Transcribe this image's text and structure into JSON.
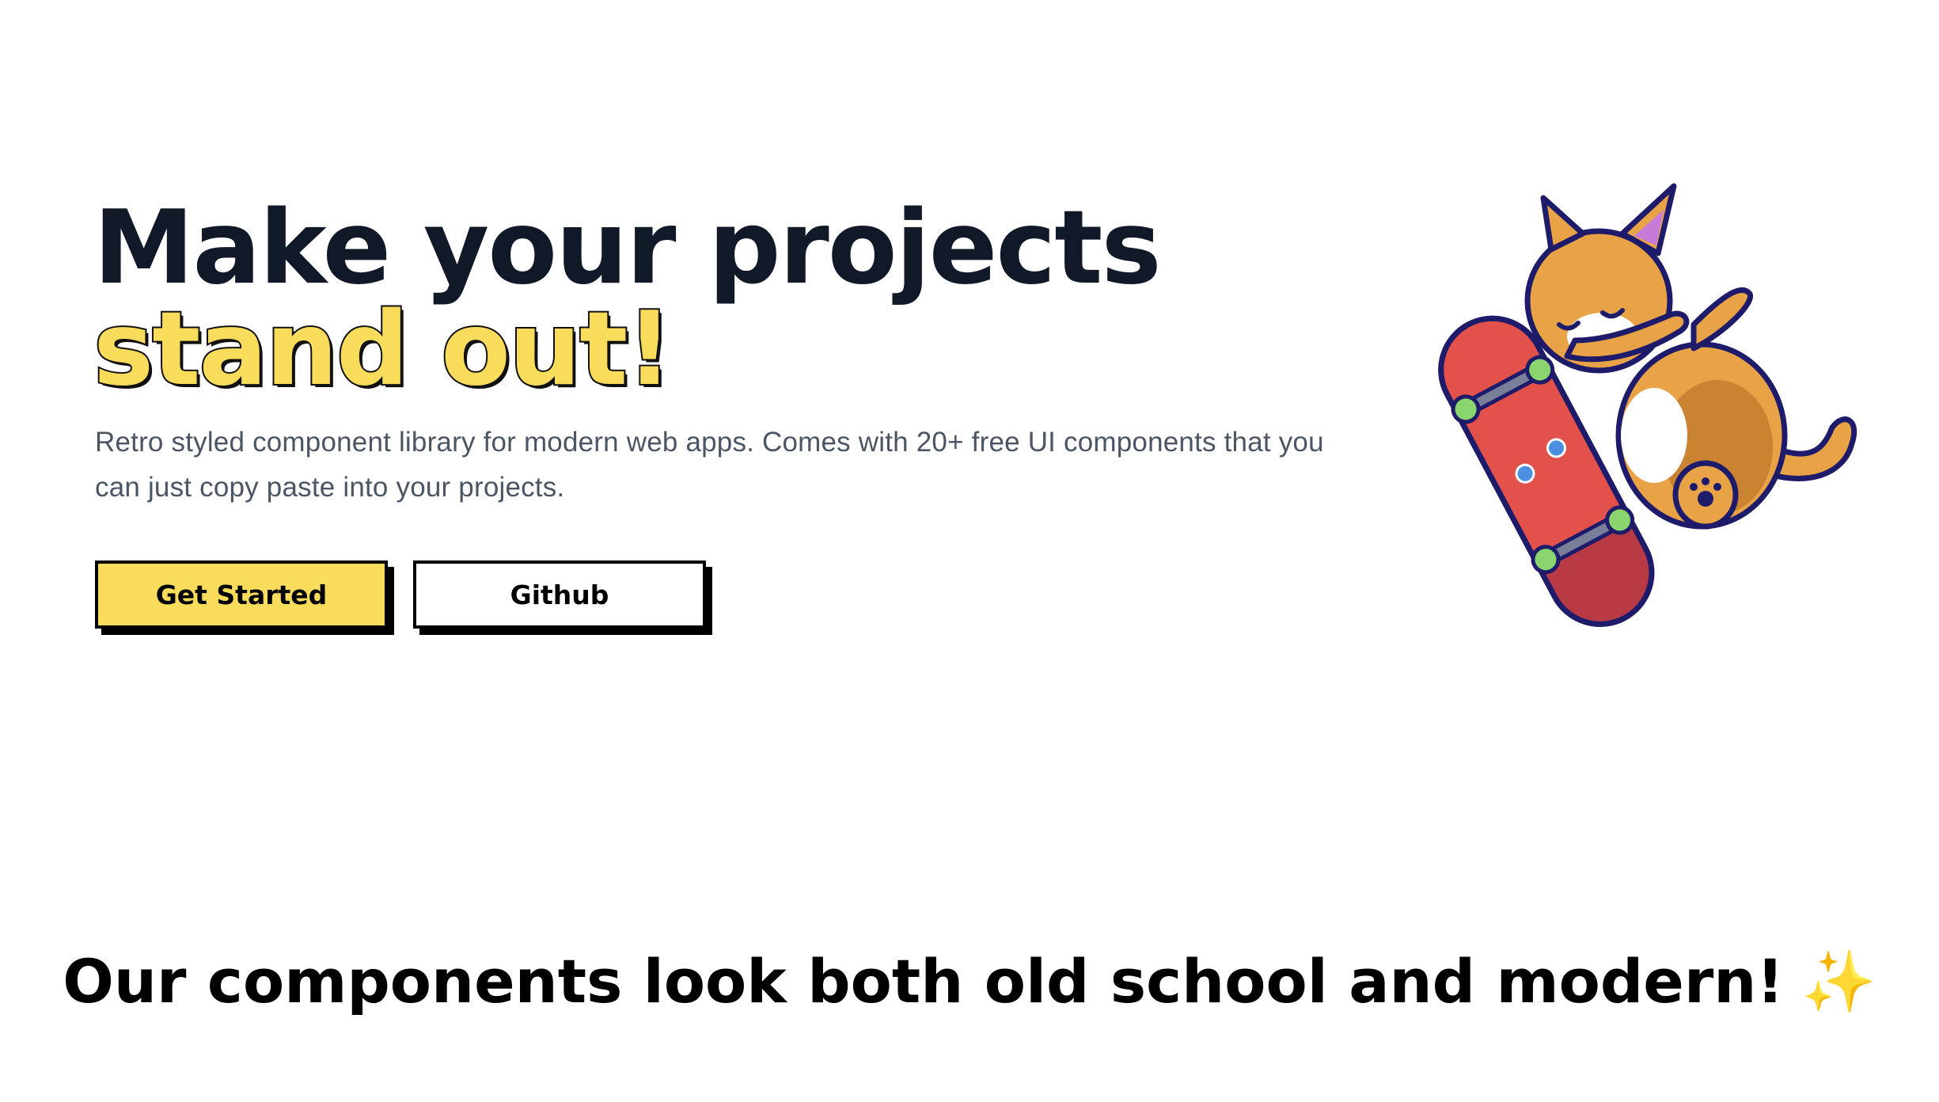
{
  "hero": {
    "headline": "Make your projects",
    "headline_accent": "stand out!",
    "description": "Retro styled component library for modern web apps. Comes with 20+ free UI components that you can just copy paste into your projects.",
    "primary_button": "Get Started",
    "secondary_button": "Github",
    "illustration_icon": "skateboarding-cat-illustration"
  },
  "features": {
    "tagline": "Our components look both old school and modern!",
    "tagline_emoji": "✨"
  },
  "colors": {
    "accent": "#f9dc5c",
    "text_dark": "#111827",
    "text_muted": "#4b5563",
    "border": "#000000"
  }
}
